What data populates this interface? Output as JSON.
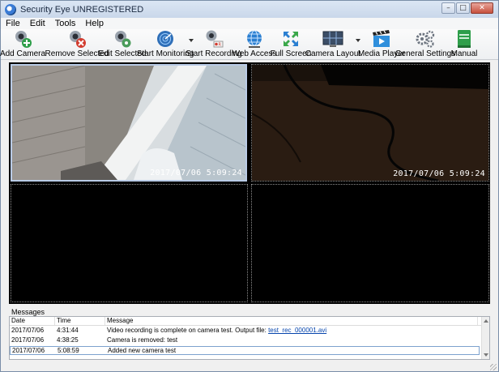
{
  "window": {
    "title": "Security Eye UNREGISTERED"
  },
  "menu": [
    "File",
    "Edit",
    "Tools",
    "Help"
  ],
  "toolbar": {
    "add_camera": "Add Camera",
    "remove_selected": "Remove Selected",
    "edit_selected": "Edit Selected",
    "start_monitoring": "Start Monitoring",
    "start_recording": "Start Recording",
    "web_access": "Web Access",
    "full_screen": "Full Screen",
    "camera_layout": "Camera Layout",
    "media_player": "Media Player",
    "general_settings": "General Settings",
    "manual": "Manual"
  },
  "cameras": {
    "cam1_timestamp": "2017/07/06 5:09:24",
    "cam2_timestamp": "2017/07/06 5:09:24"
  },
  "messages": {
    "label": "Messages",
    "columns": {
      "date": "Date",
      "time": "Time",
      "message": "Message"
    },
    "rows": [
      {
        "date": "2017/07/06",
        "time": "4:31:44",
        "message": "Video recording is complete on camera test. Output file: ",
        "link": "test_rec_000001.avi"
      },
      {
        "date": "2017/07/06",
        "time": "4:38:25",
        "message": "Camera is removed: test"
      },
      {
        "date": "2017/07/06",
        "time": "5:08:59",
        "message": "Added new camera test"
      }
    ]
  },
  "colors": {
    "accent": "#3a7bd5",
    "selection": "#7da2ce"
  }
}
